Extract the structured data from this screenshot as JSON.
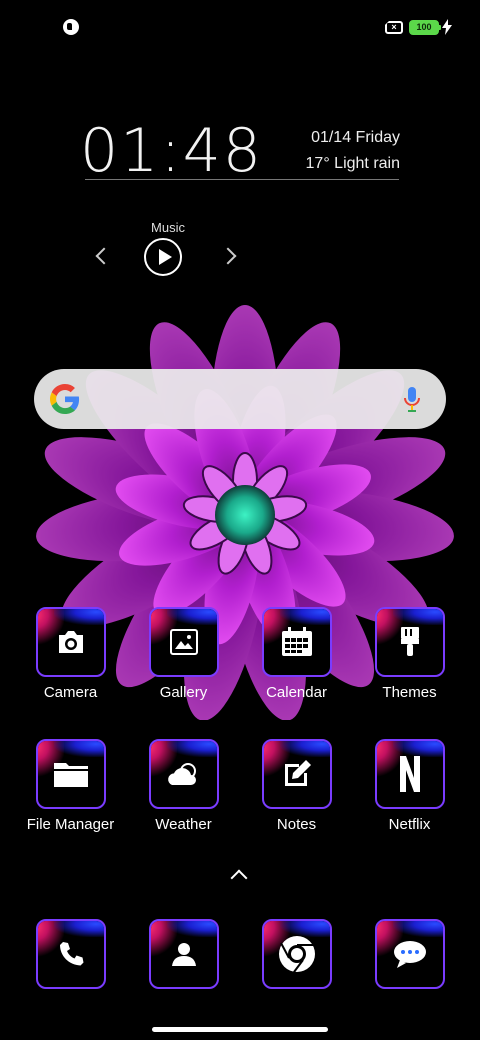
{
  "status_bar": {
    "battery_level": "100",
    "icons": [
      "notification-app-icon",
      "no-sim-icon",
      "battery-icon",
      "charging-bolt-icon"
    ]
  },
  "clock_widget": {
    "time": "01:48",
    "date": "01/14  Friday",
    "weather": "17° Light rain"
  },
  "music_widget": {
    "label": "Music"
  },
  "search_bar": {
    "icons": [
      "google-g-icon",
      "microphone-icon"
    ]
  },
  "apps_row1": [
    {
      "label": "Camera",
      "icon": "camera-icon"
    },
    {
      "label": "Gallery",
      "icon": "gallery-icon"
    },
    {
      "label": "Calendar",
      "icon": "calendar-icon"
    },
    {
      "label": "Themes",
      "icon": "paintbrush-icon"
    }
  ],
  "apps_row2": [
    {
      "label": "File Manager",
      "icon": "folder-icon"
    },
    {
      "label": "Weather",
      "icon": "weather-icon"
    },
    {
      "label": "Notes",
      "icon": "notes-icon"
    },
    {
      "label": "Netflix",
      "icon": "netflix-icon"
    }
  ],
  "dock": [
    {
      "icon": "phone-icon"
    },
    {
      "icon": "contacts-icon"
    },
    {
      "icon": "chrome-icon"
    },
    {
      "icon": "messages-icon"
    }
  ],
  "colors": {
    "background": "#000000",
    "icon_border": "#7a3cff",
    "battery": "#5bd84a",
    "flower": "#c21fd8"
  }
}
